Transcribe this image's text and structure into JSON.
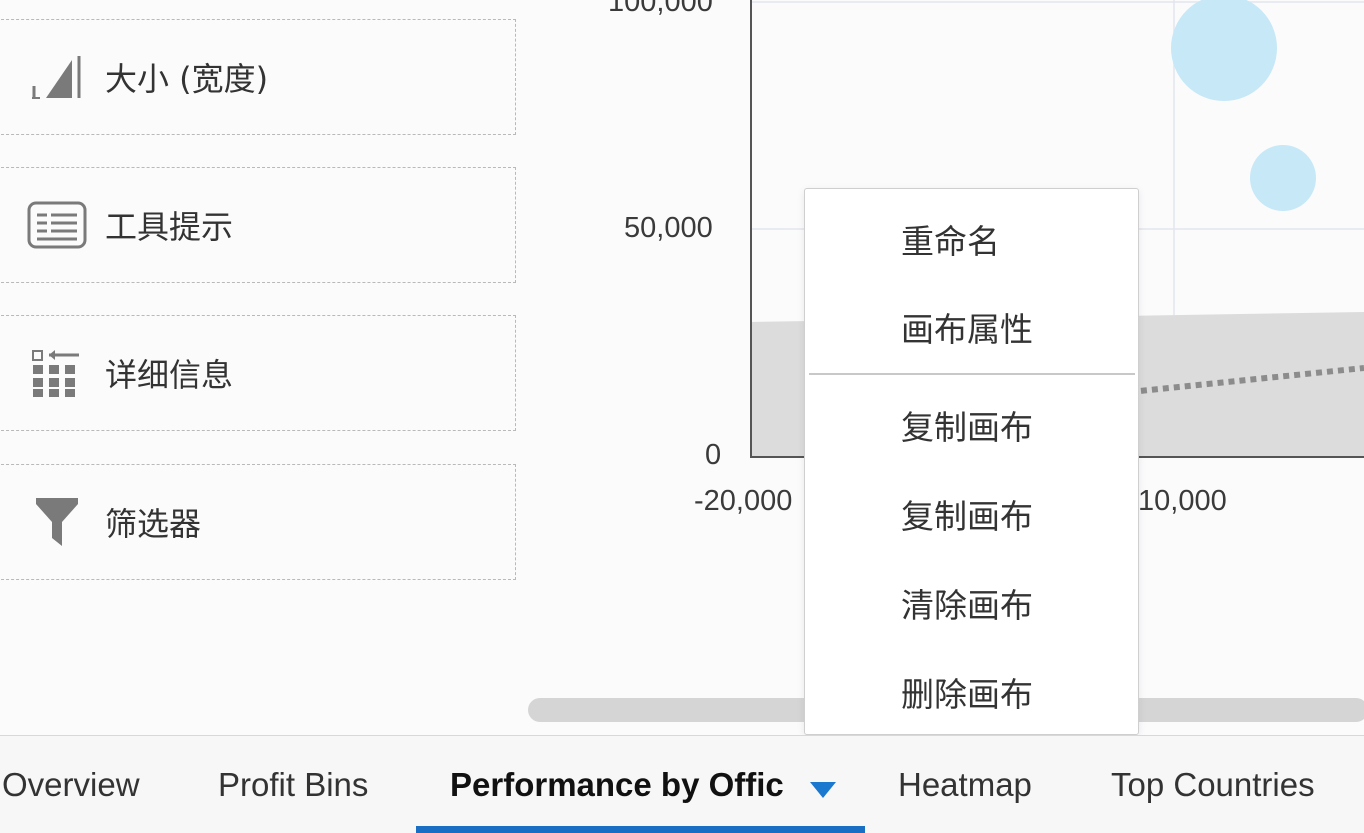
{
  "sidebar": {
    "zones": [
      {
        "label": "大小 (宽度)",
        "icon": "size-width-icon"
      },
      {
        "label": "工具提示",
        "icon": "tooltip-icon"
      },
      {
        "label": "详细信息",
        "icon": "detail-grid-icon"
      },
      {
        "label": "筛选器",
        "icon": "filter-icon"
      }
    ]
  },
  "chart_data": {
    "type": "scatter",
    "yticks": [
      "100,000",
      "50,000",
      "0"
    ],
    "xticks": [
      "-20,000",
      "10,000"
    ],
    "bubble_color": "#bfe6f6",
    "band_color": "#d9d9d9",
    "trend_color": "#8c8c8c"
  },
  "context_menu": {
    "items": [
      "重命名",
      "画布属性",
      "复制画布",
      "复制画布",
      "清除画布",
      "删除画布"
    ]
  },
  "tabs": [
    {
      "label": "Overview"
    },
    {
      "label": "Profit Bins"
    },
    {
      "label": "Performance by Offic",
      "active": true
    },
    {
      "label": "Heatmap"
    },
    {
      "label": "Top Countries"
    }
  ],
  "colors": {
    "accent": "#1a6fc4"
  }
}
